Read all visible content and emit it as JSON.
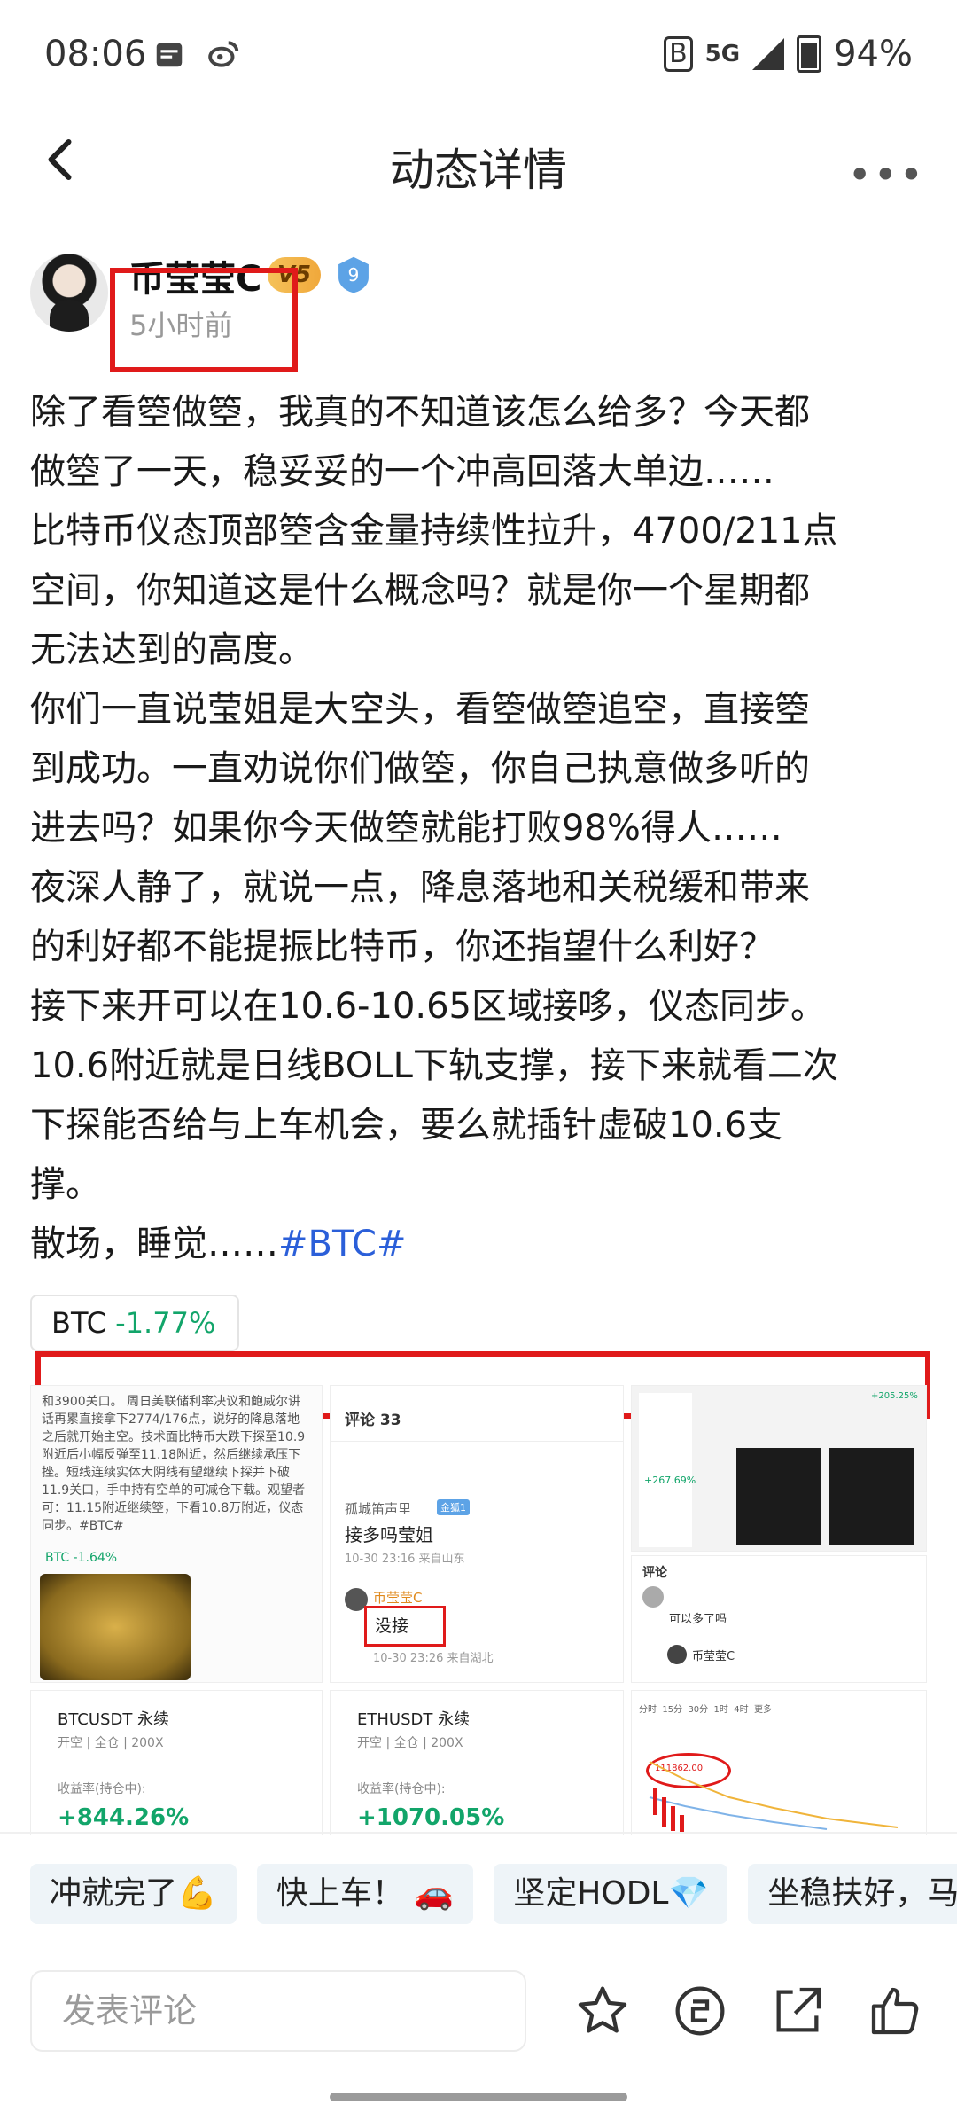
{
  "status_bar": {
    "time": "08:06",
    "network": "5G",
    "battery": "94%"
  },
  "header": {
    "title": "动态详情",
    "back_icon": "chevron-left-icon",
    "more_icon": "more-dots-icon"
  },
  "author": {
    "name": "币莹莹C",
    "vip_badge": "V5",
    "level_badge": "9",
    "posted": "5小时前"
  },
  "post": {
    "lines": [
      "除了看箜做箜，我真的不知道该怎么给多？今天都",
      "做箜了一天，稳妥妥的一个冲高回落大单边……",
      "比特币仪态顶部箜含金量持续性拉升，4700/211点",
      "空间，你知道这是什么概念吗？就是你一个星期都",
      "无法达到的高度。",
      "你们一直说莹姐是大空头，看箜做箜追空，直接箜",
      "到成功。一直劝说你们做箜，你自己执意做多听的",
      "进去吗？如果你今天做箜就能打败98%得人……",
      "夜深人静了，就说一点，降息落地和关税缓和带来",
      "的利好都不能提振比特币，你还指望什么利好？",
      "接下来开可以在10.6-10.65区域接哆，仪态同步。",
      "10.6附近就是日线BOLL下轨支撑，接下来就看二次",
      "下探能否给与上车机会，要么就插针虚破10.6支",
      "撑。"
    ],
    "last_line_text": "散场，睡觉……",
    "hashtag": "#BTC#"
  },
  "coin_chip": {
    "symbol": "BTC",
    "change": "-1.77%"
  },
  "images": {
    "img1_text": "和3900关口。 周日美联储利率决议和鲍威尔讲话再累直接拿下2774/176点，说好的降息落地之后就开始主空。技术面比特币大跌下探至10.9附近后小幅反弹至11.18附近，然后继续承压下挫。短线连续实体大阴线有望继续下探并下破11.9关口，手中持有空单的可减仓下载。观望者可：11.15附近继续箜，下看10.8万附近，仪态同步。#BTC#",
    "img1_chip": "BTC -1.64%",
    "img2_title": "评论 33",
    "img2_user": "孤城笛声里",
    "img2_tag": "金狐1",
    "img2_comment": "接多吗莹姐",
    "img2_meta": "10-30 23:16  来自山东",
    "img2_reply_user": "币莹莹C",
    "img2_reply": "没接",
    "img2_reply_meta": "10-30 23:26  来自湖北",
    "img3_pct": "+267.69%",
    "img3_top_pct": "+205.25%",
    "img3b_title": "评论",
    "img3b_comment": "可以多了吗",
    "img3b_reply_user": "币莹莹C",
    "img4_name": "BTCUSDT 永续",
    "img4_sub": "开空 | 全仓 | 200X",
    "img4_label": "收益率(持仓中):",
    "img4_value": "+844.26%",
    "img5_name": "ETHUSDT 永续",
    "img5_sub": "开空 | 全仓 | 200X",
    "img5_label": "收益率(持仓中):",
    "img5_value": "+1070.05%",
    "img6_tabs": "分时  15分  30分  1时  4时  更多",
    "img6_price": "111862.00"
  },
  "quick_replies": [
    "冲就完了💪",
    "快上车！ 🚗",
    "坚定HODL💎",
    "坐稳扶好，马"
  ],
  "bottom_bar": {
    "comment_placeholder": "发表评论",
    "icons": [
      "star-icon",
      "coin-tip-icon",
      "share-icon",
      "like-icon"
    ]
  }
}
